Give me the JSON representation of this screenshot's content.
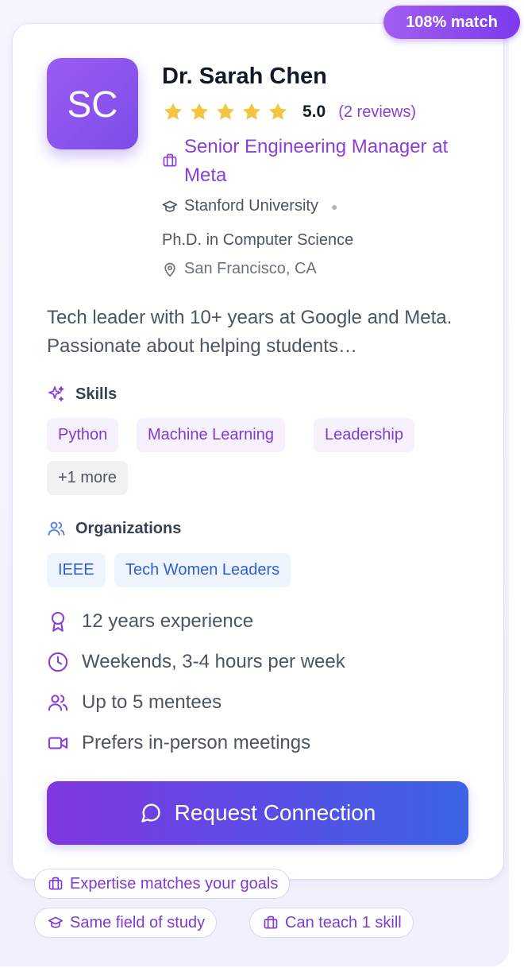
{
  "match_badge": "108% match",
  "mentor": {
    "initials": "SC",
    "name": "Dr. Sarah Chen",
    "rating": "5.0",
    "stars": 5,
    "reviews": "(2 reviews)",
    "role": "Senior Engineering Manager at Meta",
    "university": "Stanford University",
    "degree": "Ph.D. in Computer Science",
    "location": "San Francisco, CA",
    "bio": "Tech leader with 10+ years at Google and Meta. Passionate about helping students…"
  },
  "skills": {
    "title": "Skills",
    "items": [
      "Python",
      "Machine Learning",
      "Leadership"
    ],
    "more": "+1 more"
  },
  "organizations": {
    "title": "Organizations",
    "items": [
      "IEEE",
      "Tech Women Leaders"
    ]
  },
  "details": {
    "experience": "12 years experience",
    "availability": "Weekends, 3-4 hours per week",
    "capacity": "Up to 5 mentees",
    "meeting": "Prefers in-person meetings"
  },
  "cta_label": "Request Connection",
  "match_reasons": [
    "Expertise matches your goals",
    "Same field of study",
    "Can teach 1 skill"
  ],
  "colors": {
    "accent_purple": "#8b3fd9",
    "star_gold": "#f5c542",
    "cta_start": "#8136e0",
    "cta_end": "#3b64e3"
  }
}
